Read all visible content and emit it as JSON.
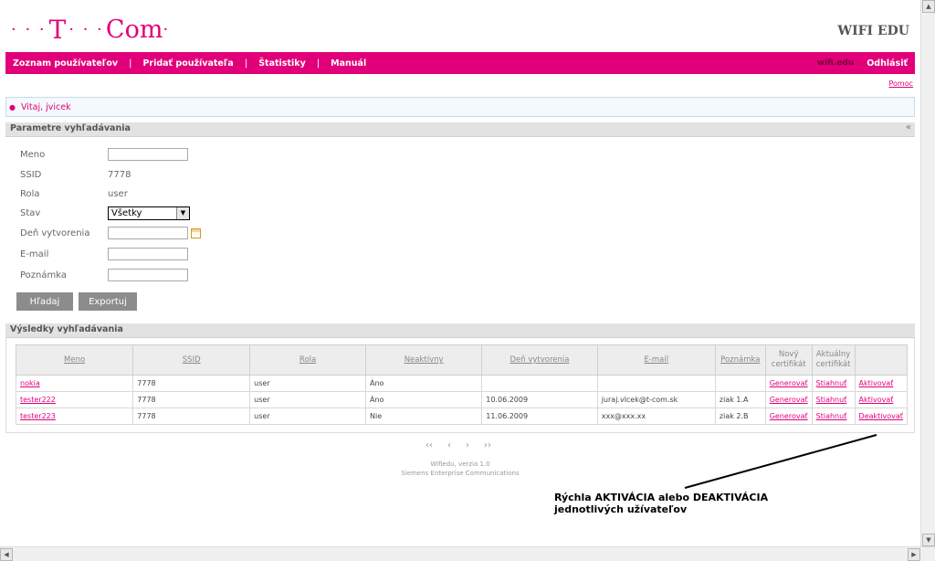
{
  "header": {
    "logo_dots_left": "· · ·",
    "logo_t": "T",
    "logo_dots_mid": "· · ·",
    "logo_com": "Com",
    "logo_dot_right": "·",
    "app_title": "WIFI EDU"
  },
  "nav": {
    "items": [
      "Zoznam používateľov",
      "Pridať používateľa",
      "Štatistiky",
      "Manuál"
    ],
    "separator": "|",
    "user": "wifi.edu",
    "logout": "Odhlásiť"
  },
  "help": "Pomoc",
  "welcome": "Vitaj, jvicek",
  "search": {
    "title": "Parametre vyhľadávania",
    "collapse": "«",
    "labels": {
      "name": "Meno",
      "ssid": "SSID",
      "role": "Rola",
      "state": "Stav",
      "created": "Deň vytvorenia",
      "email": "E-mail",
      "note": "Poznámka"
    },
    "values": {
      "name": "",
      "ssid": "7778",
      "role": "user",
      "state": "Všetky",
      "created": "",
      "email": "",
      "note": ""
    },
    "buttons": {
      "search": "Hľadaj",
      "export": "Exportuj"
    }
  },
  "results": {
    "title": "Výsledky vyhľadávania",
    "columns": [
      "Meno",
      "SSID",
      "Rola",
      "Neaktívny",
      "Deň vytvorenia",
      "E-mail",
      "Poznámka",
      "Nový certifikát",
      "Aktuálny certifikát",
      ""
    ],
    "rows": [
      {
        "name": "nokia",
        "ssid": "7778",
        "role": "user",
        "inactive": "Áno",
        "created": "",
        "email": "",
        "note": "",
        "new_cert": "Generovať",
        "cur_cert": "Stiahnuť",
        "action": "Aktivovať"
      },
      {
        "name": "tester222",
        "ssid": "7778",
        "role": "user",
        "inactive": "Áno",
        "created": "10.06.2009",
        "email": "juraj.vlcek@t-com.sk",
        "note": "ziak 1.A",
        "new_cert": "Generovať",
        "cur_cert": "Stiahnuť",
        "action": "Aktivovať"
      },
      {
        "name": "tester223",
        "ssid": "7778",
        "role": "user",
        "inactive": "Nie",
        "created": "11.06.2009",
        "email": "xxx@xxx.xx",
        "note": "ziak 2.B",
        "new_cert": "Generovať",
        "cur_cert": "Stiahnuť",
        "action": "Deaktivovať"
      }
    ]
  },
  "pager": {
    "first": "‹‹",
    "prev": "‹",
    "next": "›",
    "last": "››"
  },
  "footer": {
    "version": "Wifiedu, verzia 1.0",
    "company": "Siemens Enterprise Communications"
  },
  "annotation": {
    "line1": "Rýchla AKTIVÁCIA alebo DEAKTIVÁCIA",
    "line2": "jednotlivých užívateľov"
  },
  "colors": {
    "brand": "#e2007a",
    "section_bg": "#e2e2e2",
    "button": "#8c8c8c"
  }
}
